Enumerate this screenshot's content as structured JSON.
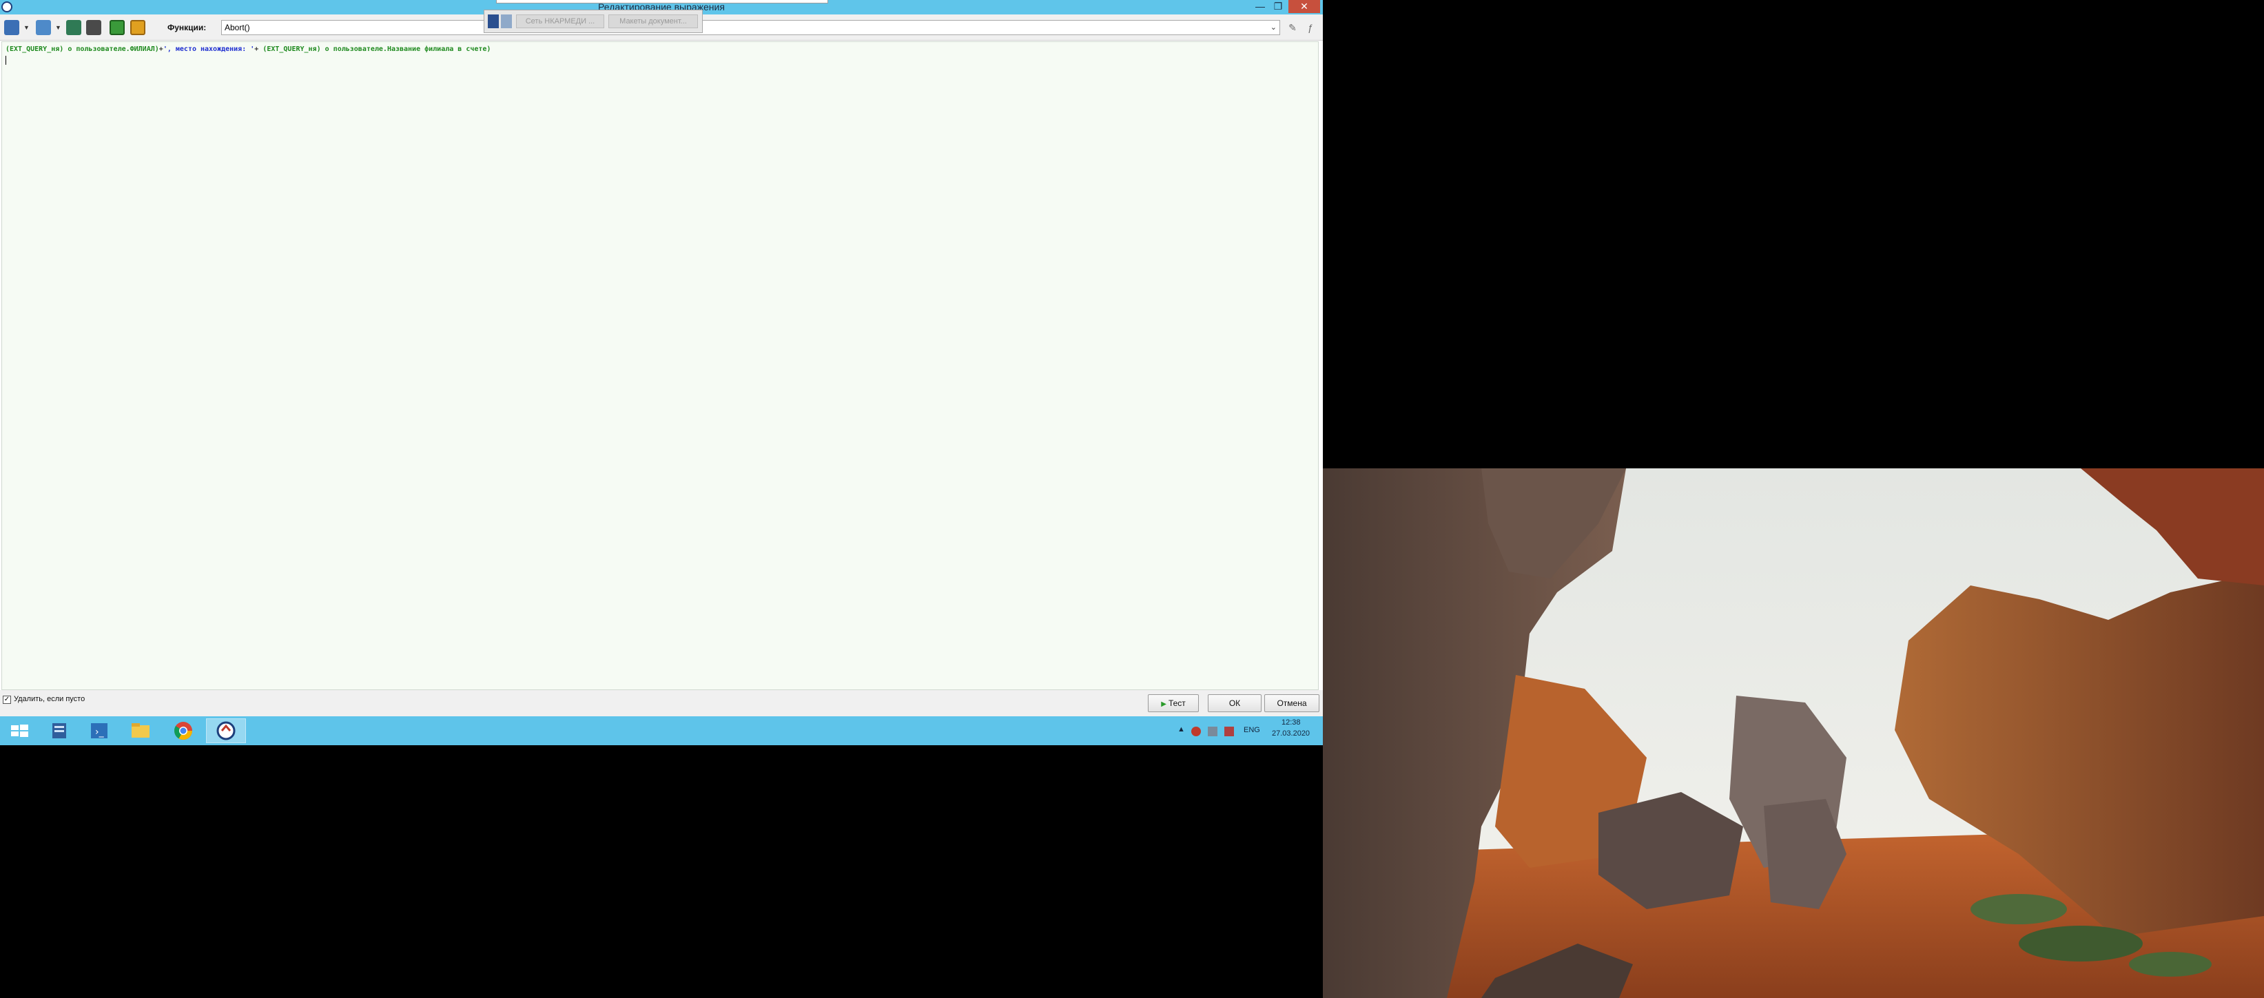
{
  "window": {
    "title": "Редактирование выражения",
    "minimize": "—",
    "maximize": "❐",
    "close": "✕"
  },
  "toolbar": {
    "functions_label": "Функции:",
    "functions_value": "Abort()"
  },
  "floating_bar": {
    "button1": "Сеть НКАРМЕДИ ...",
    "button2": "Макеты документ..."
  },
  "editor": {
    "segments": [
      {
        "text": "(EXT_QUERY_ня)",
        "color": "#1f8a1f"
      },
      {
        "text": " о пользователе.ФИЛИАЛ)",
        "color": "#1f8a1f"
      },
      {
        "text": "+",
        "color": "#333333"
      },
      {
        "text": "', место нахождения: '",
        "color": "#1f2fd0"
      },
      {
        "text": "+ ",
        "color": "#333333"
      },
      {
        "text": "(EXT_QUERY_ня)",
        "color": "#1f8a1f"
      },
      {
        "text": " о пользователе.Название филиала в счете)",
        "color": "#1f8a1f"
      }
    ]
  },
  "bottom": {
    "checkbox_label": "Удалить, если пусто",
    "checkbox_checked": true,
    "test_button": "Тест",
    "ok_button": "ОК",
    "cancel_button": "Отмена"
  },
  "taskbar": {
    "language": "ENG",
    "time": "12:38",
    "date": "27.03.2020"
  },
  "colors": {
    "titlebar": "#5fc5ea",
    "taskbar": "#5ec4ea",
    "editor_bg": "#f6fbf4"
  }
}
